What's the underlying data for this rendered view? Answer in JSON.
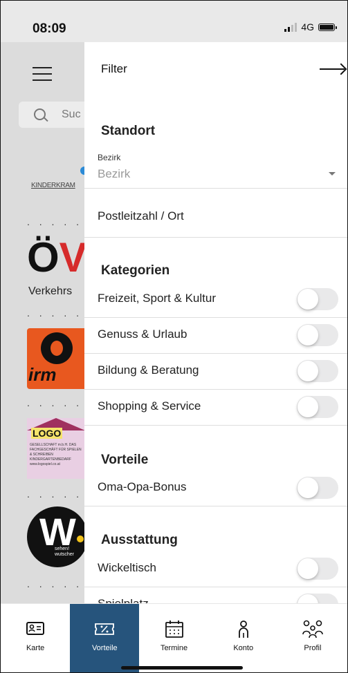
{
  "status_bar": {
    "time": "08:09",
    "network": "4G"
  },
  "background": {
    "search_placeholder": "Suc",
    "kinderkram": "KINDERKRAM",
    "dots": ". . . . . .",
    "ov_logo": "ÖV",
    "verkehr": "Verkehrs",
    "orange_logo_text": "irm",
    "pink_logo_text": "LOGO",
    "pink_logo_small": "GESELLSCHAFT m.b.H. DAS FACHGESCHÄFT FÜR SPIELEN & SCHREIBEN KINDERGARTENBEDARF www.logospiel.co.at",
    "w_logo_text": "W",
    "w_logo_sub": "sehen! wutscher"
  },
  "drawer": {
    "title": "Filter",
    "standort": {
      "heading": "Standort",
      "bezirk_label": "Bezirk",
      "bezirk_value": "Bezirk",
      "plz_label": "Postleitzahl / Ort"
    },
    "kategorien": {
      "heading": "Kategorien",
      "items": [
        {
          "label": "Freizeit, Sport & Kultur",
          "enabled": false
        },
        {
          "label": "Genuss & Urlaub",
          "enabled": false
        },
        {
          "label": "Bildung & Beratung",
          "enabled": false
        },
        {
          "label": "Shopping & Service",
          "enabled": false
        }
      ]
    },
    "vorteile": {
      "heading": "Vorteile",
      "items": [
        {
          "label": "Oma-Opa-Bonus",
          "enabled": false
        }
      ]
    },
    "ausstattung": {
      "heading": "Ausstattung",
      "items": [
        {
          "label": "Wickeltisch",
          "enabled": false
        },
        {
          "label": "Spielplatz",
          "enabled": false
        }
      ]
    }
  },
  "tabbar": {
    "active_color": "#26547c",
    "tabs": [
      {
        "label": "Karte",
        "icon": "id-card-icon"
      },
      {
        "label": "Vorteile",
        "icon": "ticket-percent-icon"
      },
      {
        "label": "Termine",
        "icon": "calendar-icon"
      },
      {
        "label": "Konto",
        "icon": "person-icon"
      },
      {
        "label": "Profil",
        "icon": "family-icon"
      }
    ]
  }
}
